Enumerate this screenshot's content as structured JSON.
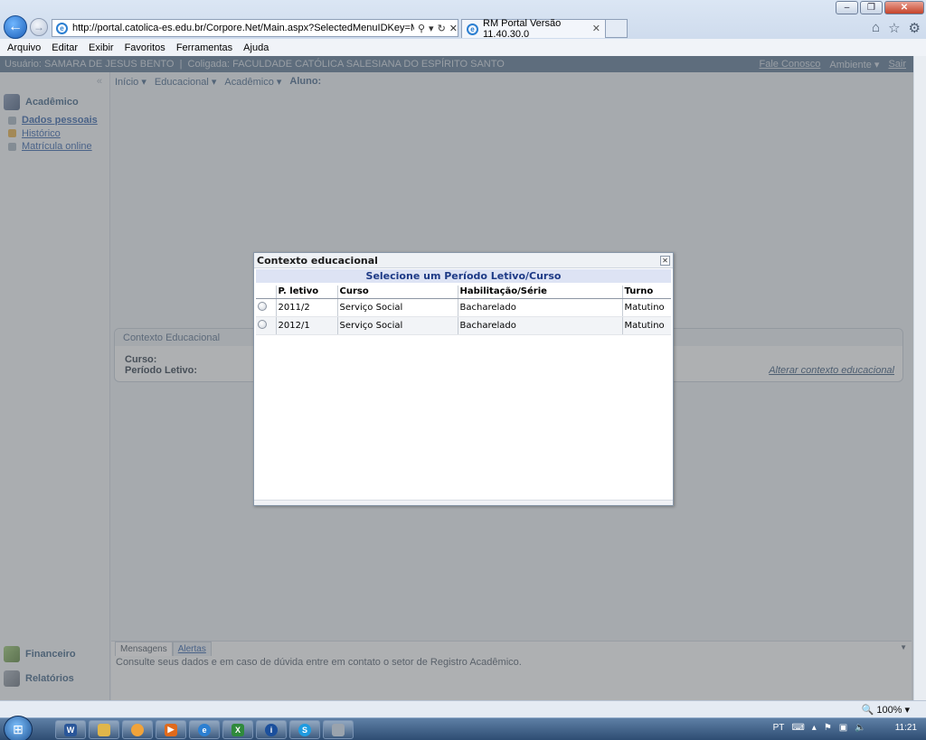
{
  "browser": {
    "address": "http://portal.catolica-es.edu.br/Corpore.Net/Main.aspx?SelectedMenuIDKey=MainEduca",
    "tab_title": "RM Portal Versão 11.40.30.0",
    "menu": [
      "Arquivo",
      "Editar",
      "Exibir",
      "Favoritos",
      "Ferramentas",
      "Ajuda"
    ],
    "zoom": "100%"
  },
  "userbar": {
    "user_info": "Usuário: SAMARA DE JESUS BENTO  |  Coligada: FACULDADE CATÓLICA SALESIANA DO ESPÍRITO SANTO",
    "fale_conosco": "Fale Conosco",
    "ambiente": "Ambiente ▾",
    "sair": "Sair"
  },
  "sidebar": {
    "heading": "Acadêmico",
    "items": [
      {
        "label": "Dados pessoais"
      },
      {
        "label": "Histórico"
      },
      {
        "label": "Matrícula online"
      }
    ],
    "bottom": [
      {
        "label": "Financeiro"
      },
      {
        "label": "Relatórios"
      }
    ]
  },
  "topnav": {
    "inicio": "Início ▾",
    "educacional": "Educacional ▾",
    "academico": "Acadêmico ▾",
    "aluno": "Aluno:"
  },
  "context_panel": {
    "title": "Contexto Educacional",
    "curso_label": "Curso:",
    "periodo_label": "Período Letivo:",
    "change_link": "Alterar contexto educacional"
  },
  "messages": {
    "tabs": [
      "Mensagens",
      "Alertas"
    ],
    "text": "Consulte seus dados e em caso de dúvida entre em contato o setor de Registro Acadêmico."
  },
  "modal": {
    "title": "Contexto educacional",
    "subtitle": "Selecione um Período Letivo/Curso",
    "columns": [
      "P. letivo",
      "Curso",
      "Habilitação/Série",
      "Turno"
    ],
    "rows": [
      [
        "2011/2",
        "Serviço Social",
        "Bacharelado",
        "Matutino"
      ],
      [
        "2012/1",
        "Serviço Social",
        "Bacharelado",
        "Matutino"
      ]
    ]
  },
  "taskbar": {
    "language": "PT",
    "clock": "11:21"
  }
}
